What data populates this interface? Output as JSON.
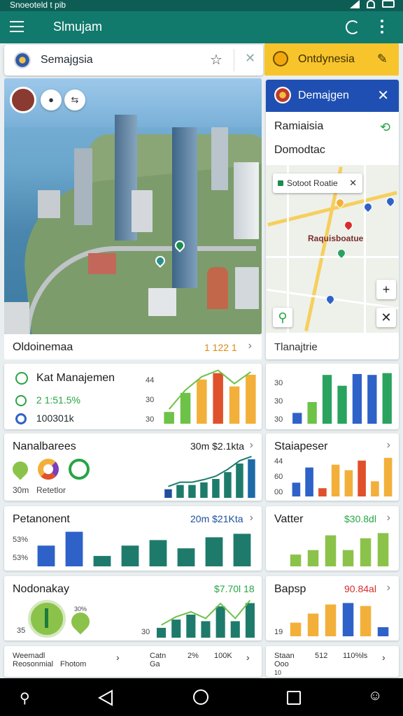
{
  "status_bar": {
    "text": "Snoeoteld  t  pib"
  },
  "app_bar": {
    "title": "Slmujam"
  },
  "search": {
    "text": "Semajgsia"
  },
  "chip": {
    "label": "Ontdynesia"
  },
  "hero": {
    "caption": "Oldoinemaa",
    "caption_value": "1 122 1"
  },
  "side_panel": {
    "title": "Demajgen",
    "line1": "Ramiaisia",
    "line2": "Domodtac",
    "map_tooltip": "Sotoot Roatie",
    "map_label": "Raquisboatue",
    "footer": "Tlanajtrie"
  },
  "cards": {
    "kat": {
      "title": "Kat Manajemen",
      "metric1": "2 1:51.5%",
      "metric2": "100301k",
      "ticks": [
        "44",
        "30",
        "30"
      ]
    },
    "side1": {
      "ticks": [
        "30",
        "30",
        "30"
      ]
    },
    "nana": {
      "title": "Nanalbarees",
      "value": "30m  $2.1kta",
      "footer_left": "30m",
      "footer_right": "Retetlor"
    },
    "staia": {
      "title": "Staiapeser",
      "ticks": [
        "44",
        "60",
        "00"
      ]
    },
    "peta": {
      "title": "Petanonent",
      "value": "20m  $21Kta",
      "ticks": [
        "53%",
        "53%"
      ]
    },
    "vatter": {
      "title": "Vatter",
      "value": "$30.8dl"
    },
    "nodo": {
      "title": "Nodonakay",
      "value": "$7.70l 18",
      "inner_left": "35",
      "inner_small": "30%",
      "tick": "30"
    },
    "bapsp": {
      "title": "Bapsp",
      "value": "90.84al",
      "tick": "19"
    }
  },
  "bottom": {
    "left": {
      "a": "Weemadl",
      "b": "Reosonmial",
      "c": "Fhotom",
      "d": "Catn",
      "e": "Ga",
      "f": "2%",
      "g": "100K"
    },
    "right": {
      "a": "Staan",
      "b": "Ooo",
      "c": "512",
      "d": "110%ls",
      "e": "10"
    }
  },
  "chart_data": [
    {
      "type": "bar",
      "name_ref": "Kat Manajemen",
      "values": [
        22,
        58,
        83,
        95,
        70,
        92
      ],
      "colors": [
        "#6dc248",
        "#6dc248",
        "#f2b03a",
        "#e0512b",
        "#f2b03a",
        "#f2b03a"
      ],
      "trend": "line"
    },
    {
      "type": "bar",
      "name_ref": "side-1",
      "values": [
        12,
        24,
        54,
        42,
        55,
        54,
        56
      ],
      "colors": [
        "#2e62c8",
        "#6dc248",
        "#2aa35f",
        "#2aa35f",
        "#2e62c8",
        "#2e62c8",
        "#2aa35f"
      ]
    },
    {
      "type": "bar",
      "name_ref": "Nanalbarees",
      "values": [
        10,
        15,
        15,
        18,
        22,
        30,
        40,
        45
      ],
      "colors": [
        "#1e4f9a",
        "#1e7b6b",
        "#1e7b6b",
        "#1e7b6b",
        "#1e7b6b",
        "#1e7b6b",
        "#1e7b6b",
        "#1e6aa8"
      ],
      "trend": "area"
    },
    {
      "type": "bar",
      "name_ref": "Staiapeser",
      "values": [
        20,
        42,
        12,
        46,
        38,
        52,
        22,
        56
      ],
      "colors": [
        "#2e62c8",
        "#2e62c8",
        "#e0512b",
        "#f2b03a",
        "#f2b03a",
        "#e0512b",
        "#f2b03a",
        "#f2b03a"
      ]
    },
    {
      "type": "bar",
      "name_ref": "Petanonent",
      "values": [
        30,
        50,
        15,
        30,
        38,
        26,
        42,
        47
      ],
      "colors": [
        "#2e62c8",
        "#2e62c8",
        "#1e7b6b",
        "#1e7b6b",
        "#1e7b6b",
        "#1e7b6b",
        "#1e7b6b",
        "#1e7b6b"
      ]
    },
    {
      "type": "bar",
      "name_ref": "Vatter",
      "values": [
        16,
        22,
        42,
        22,
        38,
        45
      ],
      "colors": [
        "#8bc34a",
        "#8bc34a",
        "#8bc34a",
        "#8bc34a",
        "#8bc34a",
        "#8bc34a"
      ]
    },
    {
      "type": "bar",
      "name_ref": "Nodonakay",
      "values": [
        12,
        22,
        28,
        20,
        38,
        20,
        42
      ],
      "colors": [
        "#1e7b6b",
        "#1e7b6b",
        "#1e7b6b",
        "#1e7b6b",
        "#1e7b6b",
        "#1e7b6b",
        "#1e7b6b"
      ],
      "trend": "line"
    },
    {
      "type": "bar",
      "name_ref": "Bapsp",
      "values": [
        18,
        30,
        42,
        44,
        40,
        12
      ],
      "colors": [
        "#f2b03a",
        "#f2b03a",
        "#f2b03a",
        "#2e62c8",
        "#f2b03a",
        "#2e62c8"
      ]
    }
  ]
}
